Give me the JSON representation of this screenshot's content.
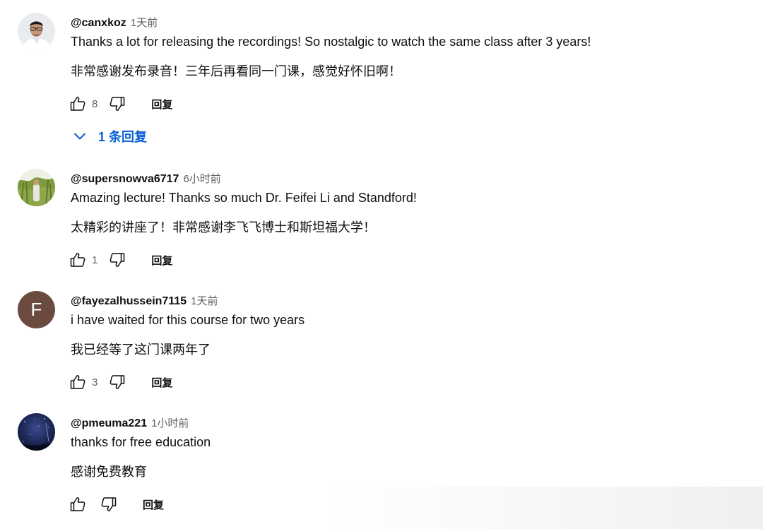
{
  "comments": [
    {
      "username": "@canxkoz",
      "timestamp": "1天前",
      "text_en": "Thanks a lot for releasing the recordings! So nostalgic to watch the same class after 3 years!",
      "text_zh": "非常感谢发布录音！三年后再看同一门课，感觉好怀旧啊！",
      "likes": "8",
      "reply_label": "回复",
      "replies_toggle": "1 条回复"
    },
    {
      "username": "@supersnowva6717",
      "timestamp": "6小时前",
      "text_en": "Amazing lecture! Thanks so much Dr. Feifei Li and Standford!",
      "text_zh": "太精彩的讲座了！非常感谢李飞飞博士和斯坦福大学！",
      "likes": "1",
      "reply_label": "回复"
    },
    {
      "username": "@fayezalhussein7115",
      "timestamp": "1天前",
      "avatar_letter": "F",
      "text_en": "i have waited for this course for two years",
      "text_zh": "我已经等了这门课两年了",
      "likes": "3",
      "reply_label": "回复"
    },
    {
      "username": "@pmeuma221",
      "timestamp": "1小时前",
      "text_en": "thanks for free education",
      "text_zh": "感谢免费教育",
      "likes": "",
      "reply_label": "回复"
    }
  ],
  "icons": {
    "like": "thumb-up-icon",
    "dislike": "thumb-down-icon",
    "expand": "chevron-down-icon"
  },
  "colors": {
    "link_blue": "#065fd4",
    "text": "#0f0f0f",
    "secondary": "#606060",
    "avatar_f_bg": "#6b4a40"
  }
}
